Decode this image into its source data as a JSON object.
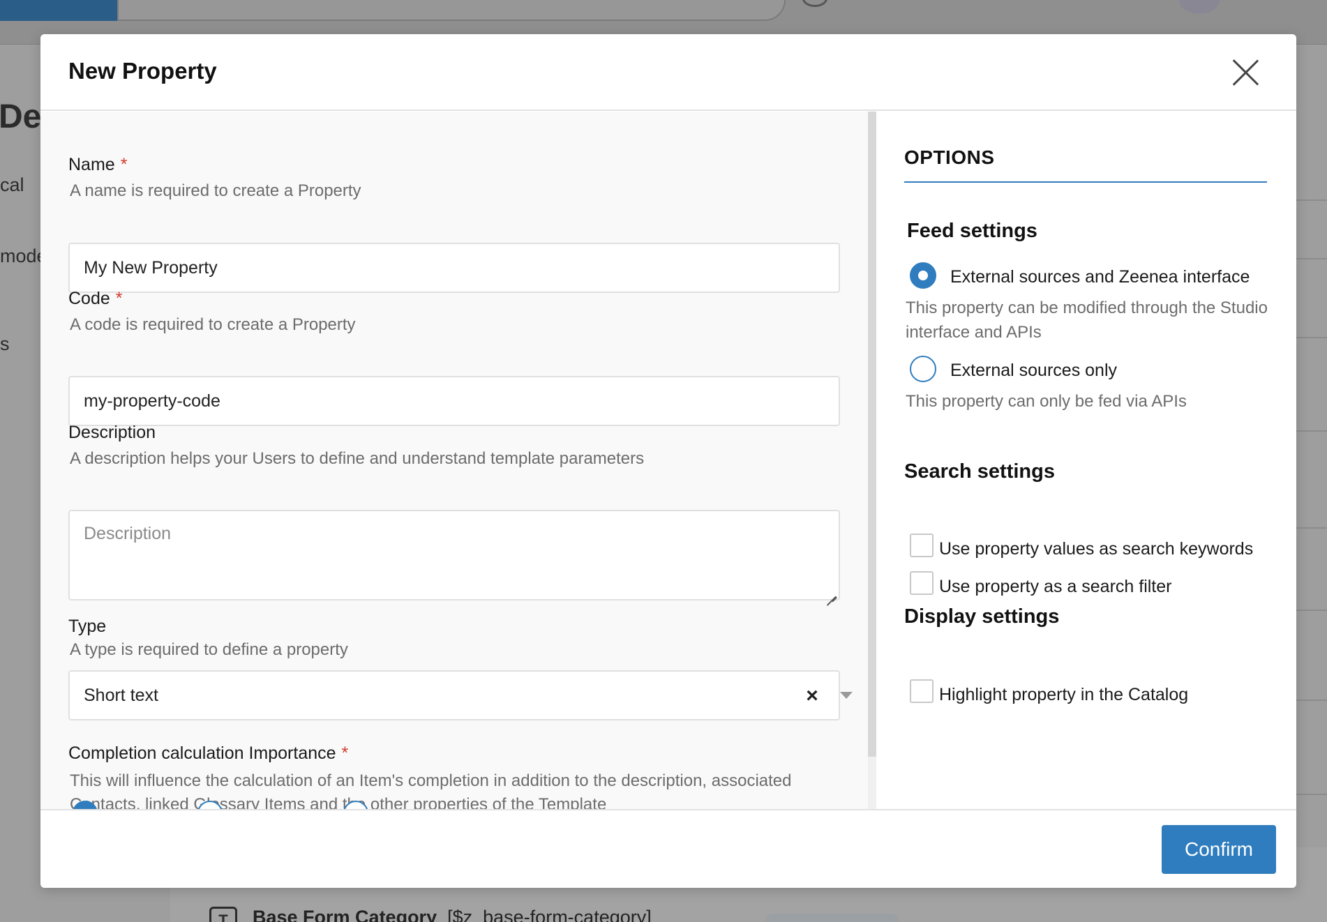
{
  "background": {
    "page_title_fragment": "De",
    "nav_fragments": [
      "cal",
      "mode",
      "s"
    ],
    "row_icon_letter": "T",
    "row_name": "Base Form Category",
    "row_code": "[$z_base-form-category]"
  },
  "modal": {
    "title": "New Property",
    "close_label": "Close",
    "confirm_label": "Confirm"
  },
  "form": {
    "name": {
      "label": "Name",
      "required_mark": "*",
      "help": "A name is required to create a Property",
      "value": "My New Property"
    },
    "code": {
      "label": "Code",
      "required_mark": "*",
      "help": "A code is required to create a Property",
      "value": "my-property-code"
    },
    "description": {
      "label": "Description",
      "help": "A description helps your Users to define and understand template parameters",
      "placeholder": "Description",
      "value": ""
    },
    "type": {
      "label": "Type",
      "help": "A type is required to define a property",
      "selected": "Short text",
      "clear_glyph": "×"
    },
    "completion": {
      "label": "Completion calculation Importance",
      "required_mark": "*",
      "help": "This will influence the calculation of an Item's completion in addition to the description, associated Contacts, linked Glossary Items and the other properties of the Template"
    }
  },
  "options": {
    "title": "OPTIONS",
    "feed": {
      "title": "Feed settings",
      "choices": [
        {
          "label": "External sources and Zeenea interface",
          "help": "This property can be modified through the Studio interface and APIs",
          "checked": true
        },
        {
          "label": "External sources only",
          "help": "This property can only be fed via APIs",
          "checked": false
        }
      ]
    },
    "search": {
      "title": "Search settings",
      "checkboxes": [
        {
          "label": "Use property values as search keywords",
          "checked": false
        },
        {
          "label": "Use property as a search filter",
          "checked": false
        }
      ]
    },
    "display": {
      "title": "Display settings",
      "checkboxes": [
        {
          "label": "Highlight property in the Catalog",
          "checked": false
        }
      ]
    }
  },
  "colors": {
    "accent": "#2f7dbe",
    "required": "#d23b2b",
    "overlay": "#9e9e9e"
  }
}
